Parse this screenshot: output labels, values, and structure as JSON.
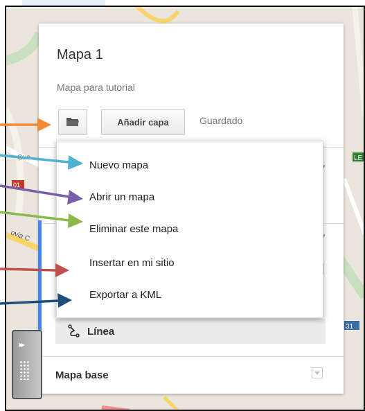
{
  "map": {
    "title": "Mapa 1",
    "description": "Mapa para tutorial",
    "add_layer_label": "Añadir capa",
    "status": "Guardado",
    "line_label": "Línea",
    "base_map_label": "Mapa base"
  },
  "menu": {
    "items": [
      {
        "label": "Nuevo mapa"
      },
      {
        "label": "Abrir un mapa"
      },
      {
        "label": "Eliminar este mapa"
      },
      {
        "label": "Insertar en mi sitio"
      },
      {
        "label": "Exportar a KML"
      }
    ]
  },
  "background_labels": {
    "road_left": "01",
    "road_right": "31",
    "corner": "LE",
    "street_1": "Gue",
    "street_2": "ovia C"
  },
  "annotation_colors": [
    "#f08a36",
    "#4fb3d0",
    "#7b5ea7",
    "#8bb84a",
    "#c0504d",
    "#1f4e79"
  ],
  "icons": {
    "open_folder": "folder-icon",
    "line_tool": "line-path-icon",
    "collapse": "double-chevron-icon",
    "base_map_toggle": "chevron-down-icon"
  }
}
